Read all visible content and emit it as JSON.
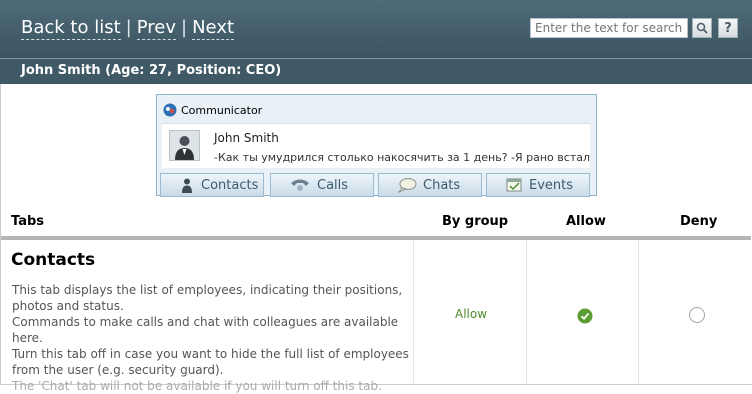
{
  "nav": {
    "back": "Back to list",
    "sep1": "|",
    "prev": "Prev",
    "sep2": "|",
    "next": "Next"
  },
  "search": {
    "placeholder": "Enter the text for search"
  },
  "help_label": "?",
  "user_bar": "John Smith (Age: 27, Position: CEO)",
  "communicator": {
    "title": "Communicator",
    "contact_name": "John Smith",
    "message": "-Как ты умудрился столько накосячить за 1 день? -Я рано встал",
    "tabs": [
      {
        "label": "Contacts",
        "icon": "person-icon"
      },
      {
        "label": "Calls",
        "icon": "phone-icon"
      },
      {
        "label": "Chats",
        "icon": "chat-bubble-icon"
      },
      {
        "label": "Events",
        "icon": "calendar-icon"
      }
    ]
  },
  "table": {
    "headers": {
      "tabs": "Tabs",
      "by_group": "By group",
      "allow": "Allow",
      "deny": "Deny"
    },
    "rows": [
      {
        "title": "Contacts",
        "description": [
          "This tab displays the list of employees, indicating their positions, photos and status.",
          "Commands to make calls and chat with colleagues are available here.",
          "Turn this tab off in case you want to hide the full list of employees from the user (e.g. security guard).",
          "The 'Chat' tab will not be available if you will turn off this tab."
        ],
        "by_group": "Allow",
        "selected": "allow"
      }
    ]
  },
  "colors": {
    "header_bg": "#3b5562",
    "allow_green": "#4f8a2a",
    "tab_text": "#3d5b6e"
  }
}
